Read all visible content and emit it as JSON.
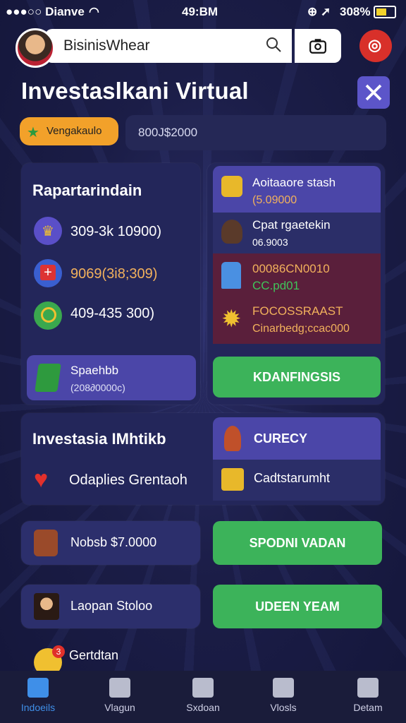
{
  "status_bar": {
    "carrier": "●●●○○ Dianve",
    "time": "49:BM",
    "battery": "308%"
  },
  "search": {
    "value": "BisinisWhear"
  },
  "page_title": "Investaslkani Virtual",
  "filter": {
    "pill_label": "Vengakaulo",
    "value_text": "800J$2000"
  },
  "left_panel": {
    "title": "Rapartarindain",
    "rows": [
      {
        "icon": "trophy-icon",
        "text": "309-3k 10900)"
      },
      {
        "icon": "plus-icon",
        "text": "9069(3i8;309)"
      },
      {
        "icon": "magnifier-icon",
        "text": "409-435 300)"
      }
    ],
    "card": {
      "title": "Spaehbb",
      "sub": "(208∂0000c)"
    }
  },
  "right_panel": {
    "items": [
      {
        "icon": "money-icon",
        "title": "Aoitaaore stash",
        "sub": "(5.09000"
      },
      {
        "icon": "person-icon",
        "title": "Cpat rgaetekin",
        "sub": "06.9003"
      },
      {
        "icon": "glass-icon",
        "title": "00086CN0010",
        "sub": "CC.pd01"
      },
      {
        "icon": "gear-icon",
        "title": "FOCOSSRAAST",
        "sub": "Cinarbedg;ccac000"
      }
    ],
    "button": "KDANFINGSIS"
  },
  "invest_panel": {
    "title": "Investasia IMhtikb",
    "row_text": "Odaplies Grentaoh",
    "items": [
      {
        "icon": "person-icon",
        "label": "CURECY"
      },
      {
        "icon": "cash-register-icon",
        "label": "Cadtstarumht"
      }
    ]
  },
  "row_a": {
    "label": "Nobsb $7.0000",
    "button": "SPODNI VADAN"
  },
  "row_b": {
    "label": "Laopan Stoloo",
    "button": "UDEEN YEAM"
  },
  "row_c": {
    "label": "Gertdtan",
    "badge": "3"
  },
  "nav": [
    {
      "label": "Indoeils",
      "icon": "home-icon"
    },
    {
      "label": "Vlagun",
      "icon": "diamond-icon"
    },
    {
      "label": "Sxdoan",
      "icon": "house-icon"
    },
    {
      "label": "Vlosls",
      "icon": "person-badge-icon"
    },
    {
      "label": "Detam",
      "icon": "list-icon"
    }
  ],
  "colors": {
    "accent_green": "#3cb35a",
    "accent_orange": "#f2a12a",
    "accent_purple": "#4b46a8",
    "active_nav": "#3f8fe8"
  }
}
